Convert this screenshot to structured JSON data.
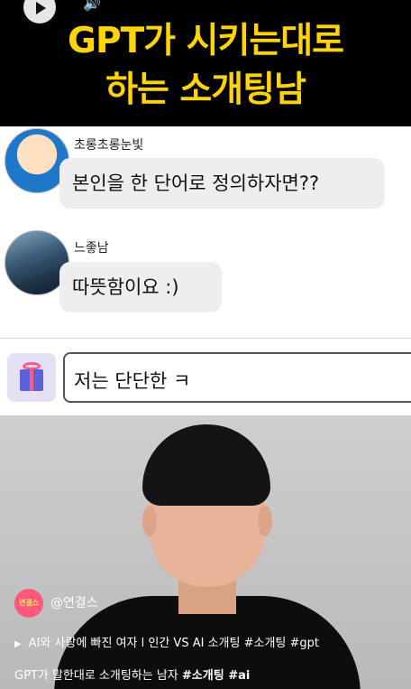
{
  "overlay_title": {
    "line1": "GPT가 시키는대로",
    "line2": "하는 소개팅남"
  },
  "chat": {
    "messages": [
      {
        "sender": "초롱초롱눈빛",
        "text": "본인을 한 단어로 정의하자면??"
      },
      {
        "sender": "느좋남",
        "text": "따뜻함이요 :)"
      }
    ],
    "input_value": "저는 단단한 ㅋ"
  },
  "channel": {
    "avatar_text": "연결스",
    "handle": "@연결스"
  },
  "related": {
    "title": "AI와 사랑에 빠진 여자 l 인간 VS AI 소개팅 #소개팅 #gpt"
  },
  "caption": {
    "text": "GPT가 말한대로 소개팅하는 남자 ",
    "tags": "#소개팅 #ai"
  },
  "icons": [
    "play-icon",
    "volume-icon",
    "fullscreen-icon",
    "gift-icon"
  ]
}
